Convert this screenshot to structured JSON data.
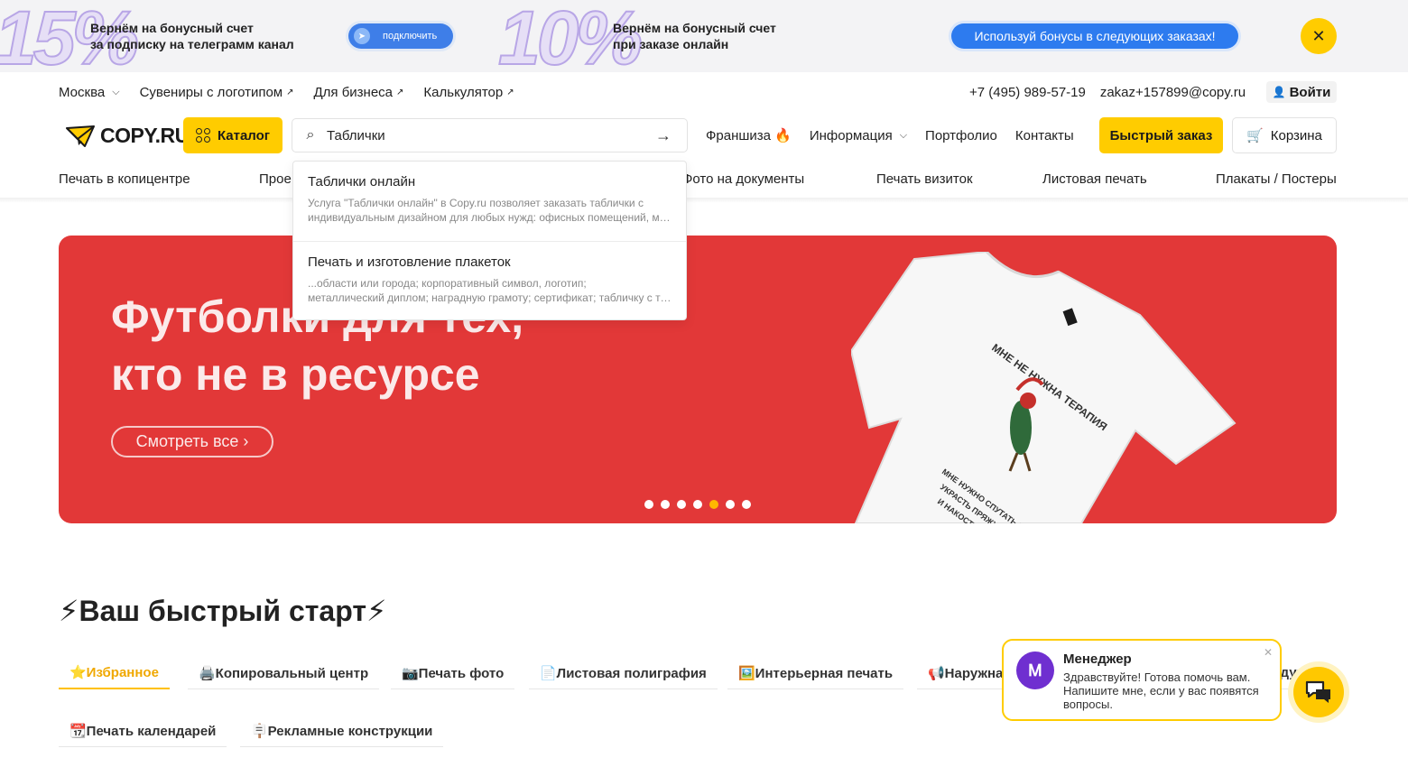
{
  "promo": {
    "num1": "15%",
    "text1": [
      "Вернём на бонусный счет",
      "за подписку на телеграмм канал"
    ],
    "connect_label": "подключить",
    "num2": "10%",
    "text2": [
      "Вернём на бонусный счет",
      "при заказе онлайн"
    ],
    "bonus_label": "Используй бонусы в следующих заказах!",
    "close_glyph": "✕"
  },
  "topbar": {
    "city": "Москва",
    "links": [
      "Сувениры с логотипом",
      "Для бизнеса",
      "Калькулятор"
    ],
    "phone": "+7 (495) 989-57-19",
    "email": "zakaz+157899@copy.ru",
    "login_label": "Войти"
  },
  "header": {
    "logo_text": "COPY.RU",
    "catalog_label": "Каталог",
    "search_value": "Таблички",
    "nav": [
      "Франшиза 🔥",
      "Информация",
      "Портфолио",
      "Контакты"
    ],
    "fast_order_label": "Быстрый заказ",
    "cart_label": "Корзина"
  },
  "categories": [
    "Печать в копицентре",
    "Прое",
    "Фото на документы",
    "Печать визиток",
    "Листовая печать",
    "Плакаты / Постеры"
  ],
  "hero": {
    "title_line1": "Футболки для тех,",
    "title_line2": "кто не в ресурсе",
    "button_label": "Смотреть все ›",
    "slide_count": 7,
    "active_slide": 5,
    "tshirt_text1": "МНЕ НЕ НУЖНА ТЕРАПИЯ",
    "tshirt_text2": [
      "МНЕ НУЖНО СПУТАТЬ НИТКИ,",
      "УКРАСТЬ ПРЯЖУ",
      "И НАКОСТИТЬ"
    ]
  },
  "suggestions": [
    {
      "title": "Таблички онлайн",
      "desc": [
        "Услуга \"Таблички онлайн\" в Copy.ru позволяет заказать таблички с",
        "индивидуальным дизайном для любых нужд: офисных помещений, магазинов"
      ]
    },
    {
      "title": "Печать и изготовление плакеток",
      "desc": [
        "...области или города; корпоративный символ, логотип;",
        "металлический диплом; наградную грамоту; сертификат; табличку с текстом"
      ]
    }
  ],
  "quickstart": {
    "title": "⚡Ваш быстрый старт⚡",
    "tabs": [
      "⭐Избранное",
      "🖨️Копировальный центр",
      "📷Печать фото",
      "📄Листовая полиграфия",
      "🖼️Интерьерная печать",
      "📢Наружная реклама",
      "Сувенирная продукция",
      "📆Печать календарей",
      "🪧Рекламные конструкции"
    ]
  },
  "chat": {
    "name": "Менеджер",
    "message": "Здравствуйте! Готова помочь вам. Напишите мне, если у вас появятся вопросы.",
    "avatar_letter": "Ꮇ",
    "close_glyph": "✕"
  },
  "colors": {
    "accent": "#ffcc00",
    "hero_bg": "#e23838",
    "promo_blue": "#2d7bef"
  }
}
